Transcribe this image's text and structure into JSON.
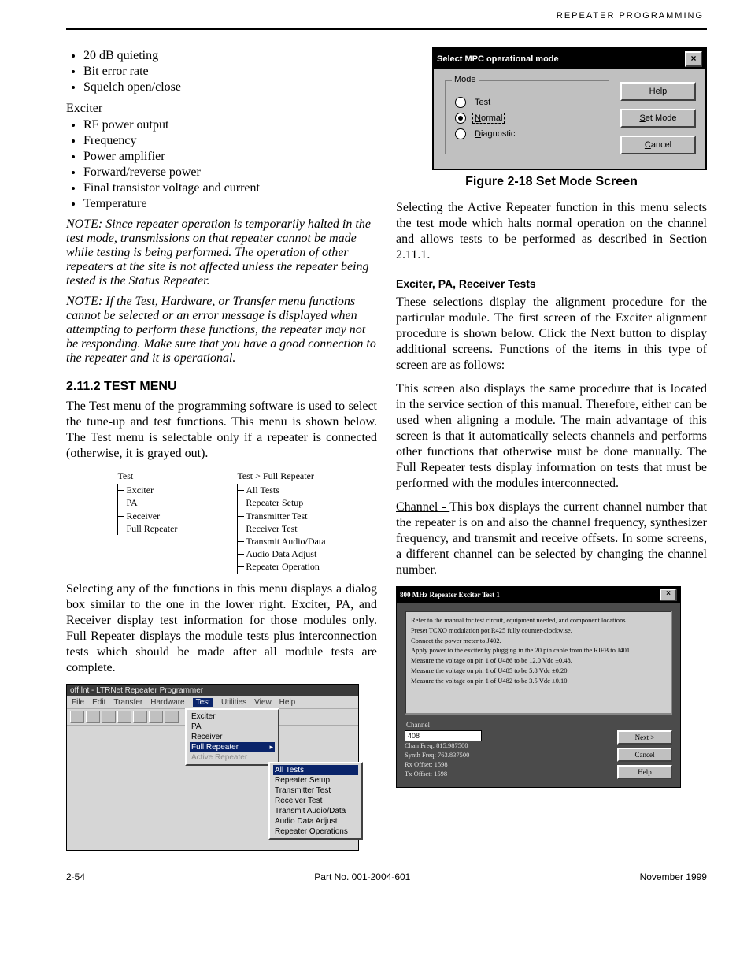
{
  "page": {
    "running_head": "REPEATER PROGRAMMING",
    "footer_left": "2-54",
    "footer_right": "November 1999",
    "footer_center": "Part No. 001-2004-601"
  },
  "left": {
    "bullets": [
      "20 dB quieting",
      "Bit error rate",
      "Squelch open/close"
    ],
    "exciter_head": "Exciter",
    "exciter_items": [
      "RF power output",
      "Frequency",
      "Power amplifier",
      "Forward/reverse power",
      "Final transistor voltage and current",
      "Temperature"
    ],
    "note1_label": "NOTE:",
    "note1_body": "  Since repeater operation is temporarily halted in the test mode, transmissions on that repeater cannot be made while testing is being performed. The operation of other repeaters at the site is not affected unless the repeater being tested is the Status Repeater.",
    "note2_label": "NOTE:",
    "note2_body": "  If the Test, Hardware, or Transfer menu functions cannot be selected or an error message is displayed when attempting to perform these functions, the repeater may not be responding. Make sure that you have a good connection to the repeater and it is operational.",
    "test_menu_title": "2.11.2 TEST MENU",
    "test_menu_p1": "The Test menu of the programming software is used to select the tune-up and test functions. This menu is shown below. The Test menu is selectable only if a repeater is connected (otherwise, it is grayed out).",
    "test_menu_p2": "Selecting any of the functions in this menu displays a dialog box similar to the one in the lower right. Exciter, PA, and Receiver display test information for those modules only. Full Repeater displays the module tests plus interconnection tests which should be made after all module tests are complete.",
    "menu_tree": {
      "left_head": "Test",
      "left_items": [
        "Exciter",
        "PA",
        "Receiver",
        "Full Repeater"
      ],
      "right_head": "Test > Full Repeater",
      "right_items": [
        "All Tests",
        "Repeater Setup",
        "Transmitter Test",
        "Receiver Test",
        "Transmit Audio/Data",
        "Audio Data Adjust",
        "Repeater Operation"
      ]
    }
  },
  "right": {
    "mode_dialog": {
      "title": "Select MPC operational mode",
      "group_caption": "Mode",
      "opt_test": "Test",
      "opt_normal": "Normal",
      "opt_diag": "Diagnostic",
      "btn_help": "Help",
      "btn_set": "Set Mode",
      "btn_cancel": "Cancel"
    },
    "fig_label": "Figure 2-18   Set Mode Screen",
    "p_after_fig": "Selecting the Active Repeater function in this menu selects the test mode which halts normal operation on the channel and allows tests to be performed as described in Section 2.11.1.",
    "sub_title": "Exciter, PA, Receiver Tests",
    "p_explain": "These selections display the alignment procedure for the particular module. The first screen of the Exciter alignment procedure is shown below. Click the Next button to display additional screens. Functions of the items in this type of screen are as follows:",
    "full_body": "This screen also displays the same procedure that is located in the service section of this manual. Therefore, either can be used when aligning a module. The main advantage of this screen is that it automatically selects channels and performs other functions that otherwise must be done manually. The Full Repeater tests display information on tests that must be performed with the modules interconnected.",
    "channel_label": "Channel - ",
    "channel_body": "This box displays the current channel number that the repeater is on and also the channel frequency, synthesizer frequency, and transmit and receive offsets. In some screens, a different channel can be selected by changing the channel number."
  },
  "prog": {
    "title": "off.lnt - LTRNet Repeater Programmer",
    "menus": [
      "File",
      "Edit",
      "Transfer",
      "Hardware",
      "Test",
      "Utilities",
      "View",
      "Help"
    ],
    "dropdown": {
      "items": [
        "Exciter",
        "PA",
        "Receiver",
        "Full Repeater",
        "Active Repeater"
      ],
      "selected": "Full Repeater",
      "disabled": "Active Repeater"
    },
    "submenu": {
      "items": [
        "All Tests",
        "Repeater Setup",
        "Transmitter Test",
        "Receiver Test",
        "Transmit Audio/Data",
        "Audio Data Adjust",
        "Repeater Operations"
      ],
      "selected": "All Tests"
    }
  },
  "exciter": {
    "title": "800 MHz Repeater Exciter Test 1",
    "lines": [
      "Refer to the manual for test circuit, equipment needed, and component locations.",
      "Preset TCXO modulation pot R425 fully counter-clockwise.",
      "Connect the power meter to J402.",
      "Apply power to the exciter by plugging in the 20 pin cable from the RIFB to J401.",
      "Measure the voltage on pin 1 of U486 to be 12.0 Vdc ±0.48.",
      "Measure the voltage on pin 1 of U485 to be 5.8 Vdc ±0.20.",
      "Measure the voltage on pin 1 of U482 to be 3.5 Vdc ±0.10."
    ],
    "channel_label": "Channel",
    "channel_value": "408",
    "info": {
      "chan_freq": "Chan Freq:  815.987500",
      "synth_freq": "Synth Freq:  763.837500",
      "rx_offset": "Rx Offset:  1598",
      "tx_offset": "Tx Offset:  1598"
    },
    "btn_next": "Next >",
    "btn_cancel": "Cancel",
    "btn_help": "Help"
  }
}
